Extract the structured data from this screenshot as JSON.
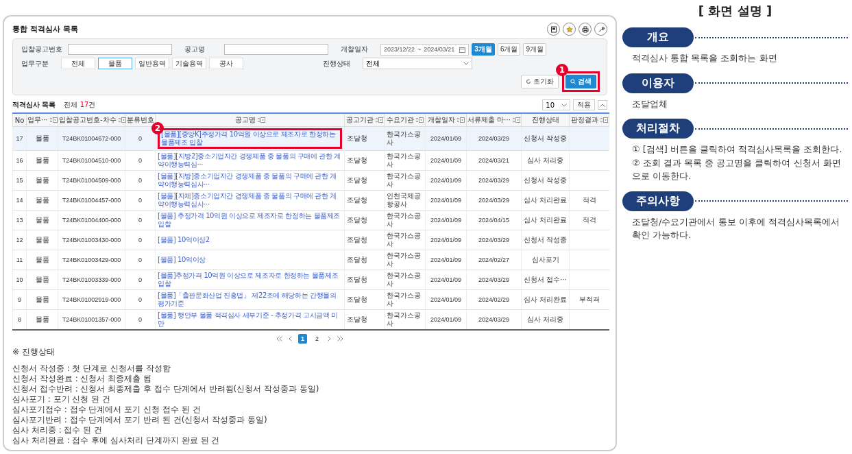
{
  "screen": {
    "title": "통합 적격심사 목록",
    "search": {
      "fields": [
        {
          "label": "입찰공고번호",
          "kind": "text"
        },
        {
          "label": "공고명",
          "kind": "text"
        }
      ],
      "period": {
        "label": "개찰일자",
        "from": "2023/12/22",
        "separator": "~",
        "to": "2024/03/21",
        "options": [
          {
            "label": "3개월",
            "selected": true
          },
          {
            "label": "6개월",
            "selected": false
          },
          {
            "label": "9개월",
            "selected": false
          }
        ]
      },
      "business": {
        "label": "업무구분",
        "options": [
          {
            "label": "전체",
            "selected": false
          },
          {
            "label": "물품",
            "selected": true
          },
          {
            "label": "일반용역",
            "selected": false
          },
          {
            "label": "기술용역",
            "selected": false
          },
          {
            "label": "공사",
            "selected": false
          }
        ]
      },
      "status": {
        "label": "진행상태",
        "value": "전체"
      },
      "reset_button": "초기화",
      "search_button": {
        "label": "검색",
        "callout": "1"
      }
    },
    "list": {
      "title": "적격심사 목록",
      "total_label": "전체",
      "total_count": "17",
      "total_unit": "건",
      "page_size": "10",
      "apply_button": "적용"
    },
    "table": {
      "columns": [
        {
          "label": "No",
          "sortable": false
        },
        {
          "label": "업무···",
          "sortable": true
        },
        {
          "label": "입찰공고번호-차수",
          "sortable": true
        },
        {
          "label": "분류번호",
          "sortable": false
        },
        {
          "label": "공고명",
          "sortable": true
        },
        {
          "label": "공고기관",
          "sortable": true
        },
        {
          "label": "수요기관",
          "sortable": true
        },
        {
          "label": "개찰일자",
          "sortable": true
        },
        {
          "label": "서류제출 마···",
          "sortable": true
        },
        {
          "label": "진행상태",
          "sortable": false
        },
        {
          "label": "판정결과",
          "sortable": true
        }
      ],
      "rows": [
        {
          "selected": true,
          "callout": "2",
          "cells": [
            "17",
            "물품",
            "T24BK01004672-000",
            "0",
            "[물품][중앙K]주정가격 10억원 이상으로 제조자로 한정하는 물품제조 입찰",
            "조달청",
            "한국가스공사",
            "2024/01/09",
            "2024/03/29",
            "신청서 작성중",
            ""
          ]
        },
        {
          "selected": false,
          "cells": [
            "16",
            "물품",
            "T24BK01004510-000",
            "0",
            "[물품][지방2]중소기업자간 경쟁제품 중 물품의 구매에 관한 계약이행능력심···",
            "조달청",
            "한국가스공사",
            "2024/01/09",
            "2024/03/21",
            "심사 처리중",
            ""
          ]
        },
        {
          "selected": false,
          "cells": [
            "15",
            "물품",
            "T24BK01004509-000",
            "0",
            "[물품][지방]중소기업자간 경쟁제품 중 물품의 구매에 관한 계약이행능력심사···",
            "조달청",
            "한국가스공사",
            "2024/01/09",
            "2024/03/29",
            "신청서 작성중",
            ""
          ]
        },
        {
          "selected": false,
          "cells": [
            "14",
            "물품",
            "T24BK01004457-000",
            "0",
            "[물품][자체]중소기업자간 경쟁제품 중 물품의 구매에 관한 계약이행능력심사···",
            "조달청",
            "인천국제공항공사",
            "2024/01/09",
            "2024/03/29",
            "심사 처리완료",
            "적격"
          ]
        },
        {
          "selected": false,
          "cells": [
            "13",
            "물품",
            "T24BK01004400-000",
            "0",
            "[물품] 추정가격 10억원 이상으로 제조자로 한정하는 물품제조 입찰",
            "조달청",
            "한국가스공사",
            "2024/01/09",
            "2024/04/15",
            "심사 처리완료",
            "적격"
          ]
        },
        {
          "selected": false,
          "cells": [
            "12",
            "물품",
            "T24BK01003430-000",
            "0",
            "[물품] 10억이상2",
            "조달청",
            "한국가스공사",
            "2024/01/09",
            "2024/03/29",
            "신청서 작성중",
            ""
          ]
        },
        {
          "selected": false,
          "cells": [
            "11",
            "물품",
            "T24BK01003429-000",
            "0",
            "[물품] 10억이상",
            "조달청",
            "한국가스공사",
            "2024/01/09",
            "2024/02/27",
            "심사포기",
            ""
          ]
        },
        {
          "selected": false,
          "cells": [
            "10",
            "물품",
            "T24BK01003339-000",
            "0",
            "[물품]추정가격 10억원 이상으로 제조자로 한정하는 물품제조 입찰",
            "조달청",
            "한국가스공사",
            "2024/01/09",
            "2024/03/29",
            "신청서 접수···",
            ""
          ]
        },
        {
          "selected": false,
          "cells": [
            "9",
            "물품",
            "T24BK01002919-000",
            "0",
            "[물품]「출판문화산업 진흥법」 제22조에 해당하는 간행물의 평가기준",
            "조달청",
            "한국가스공사",
            "2024/01/09",
            "2024/02/29",
            "심사 처리완료",
            "부적격"
          ]
        },
        {
          "selected": false,
          "cells": [
            "8",
            "물품",
            "T24BK01001357-000",
            "0",
            "[물품] 행안부 물품 적격심사 세부기준 - 추정가격 고시금액 미만",
            "조달청",
            "한국가스공사",
            "2024/01/09",
            "2024/03/29",
            "심사 처리중",
            ""
          ]
        }
      ]
    },
    "pagination": {
      "pages": [
        {
          "label": "1",
          "selected": true
        },
        {
          "label": "2",
          "selected": false
        }
      ]
    }
  },
  "notes": {
    "heading": "※ 진행상태",
    "lines": [
      "신청서 작성중 : 첫 단계로 신청서를 작성함",
      "신청서 작성완료 : 신청서 최종제출 됨",
      "신청서 접수반려 : 신청서 최종제출 후 접수 단계에서 반려됨(신청서 작성중과 동일)",
      "심사포기 : 포기 신청 된 건",
      "심사포기접수 : 접수 단계에서 포기 신청 접수 된 건",
      "심사포기반려 : 접수 단계에서 포기 반려 된 건(신청서 작성중과 동일)",
      "심사 처리중 : 접수 된 건",
      "심사 처리완료 : 접수 후에 심사처리 단계까지 완료 된 건"
    ]
  },
  "description": {
    "title": "[ 화면 설명 ]",
    "sections": [
      {
        "heading": "개요",
        "lines": [
          "적격심사 통합 목록을 조회하는 화면"
        ]
      },
      {
        "heading": "이용자",
        "lines": [
          "조달업체"
        ]
      },
      {
        "heading": "처리절차",
        "lines": [
          "① [검색] 버튼을 클릭하여 적격심사목록을 조회한다.",
          "② 조회 결과 목록 중 공고명을 클릭하여 신청서 화면으로 이동한다."
        ]
      },
      {
        "heading": "주의사항",
        "lines": [
          "조달청/수요기관에서 통보 이후에 적격심사목록에서 확인 가능하다."
        ]
      }
    ]
  }
}
